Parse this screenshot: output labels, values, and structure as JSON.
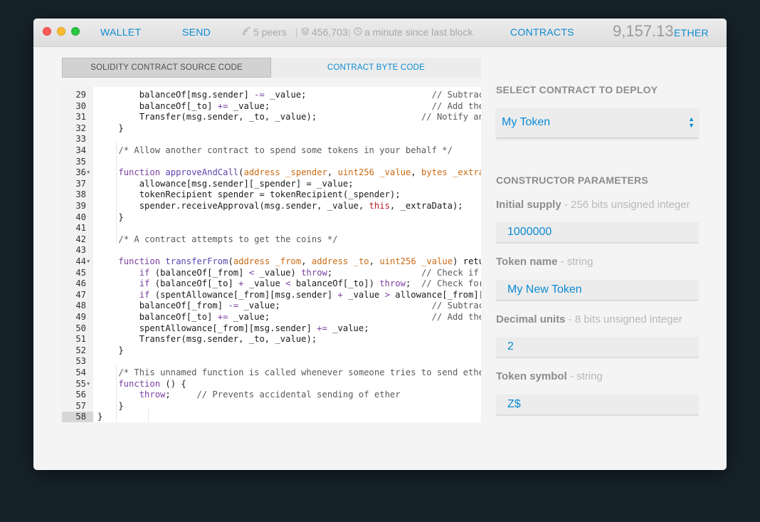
{
  "titlebar": {
    "nav": {
      "wallet": "WALLET",
      "send": "SEND",
      "contracts": "CONTRACTS"
    },
    "stats": {
      "peers": "5 peers",
      "block": "456,703",
      "last_block": "a minute since last block"
    },
    "balance": {
      "amount": "9,157.13",
      "unit": "ETHER"
    }
  },
  "tabs": {
    "source": "SOLIDITY CONTRACT SOURCE CODE",
    "bytecode": "CONTRACT BYTE CODE"
  },
  "editor": {
    "lines": [
      {
        "n": "29",
        "fold": false,
        "current": false
      },
      {
        "n": "30",
        "fold": false,
        "current": false
      },
      {
        "n": "31",
        "fold": false,
        "current": false
      },
      {
        "n": "32",
        "fold": false,
        "current": false
      },
      {
        "n": "33",
        "fold": false,
        "current": false
      },
      {
        "n": "34",
        "fold": false,
        "current": false
      },
      {
        "n": "35",
        "fold": false,
        "current": false
      },
      {
        "n": "36",
        "fold": true,
        "current": false
      },
      {
        "n": "37",
        "fold": false,
        "current": false
      },
      {
        "n": "38",
        "fold": false,
        "current": false
      },
      {
        "n": "39",
        "fold": false,
        "current": false
      },
      {
        "n": "40",
        "fold": false,
        "current": false
      },
      {
        "n": "41",
        "fold": false,
        "current": false
      },
      {
        "n": "42",
        "fold": false,
        "current": false
      },
      {
        "n": "43",
        "fold": false,
        "current": false
      },
      {
        "n": "44",
        "fold": true,
        "current": false
      },
      {
        "n": "45",
        "fold": false,
        "current": false
      },
      {
        "n": "46",
        "fold": false,
        "current": false
      },
      {
        "n": "47",
        "fold": false,
        "current": false
      },
      {
        "n": "48",
        "fold": false,
        "current": false
      },
      {
        "n": "49",
        "fold": false,
        "current": false
      },
      {
        "n": "50",
        "fold": false,
        "current": false
      },
      {
        "n": "51",
        "fold": false,
        "current": false
      },
      {
        "n": "52",
        "fold": false,
        "current": false
      },
      {
        "n": "53",
        "fold": false,
        "current": false
      },
      {
        "n": "54",
        "fold": false,
        "current": false
      },
      {
        "n": "55",
        "fold": true,
        "current": false
      },
      {
        "n": "56",
        "fold": false,
        "current": false
      },
      {
        "n": "57",
        "fold": false,
        "current": false
      },
      {
        "n": "58",
        "fold": false,
        "current": true
      }
    ],
    "code": [
      [
        [
          "",
          "        balanceOf[msg.sender] "
        ],
        [
          "k",
          "-="
        ],
        [
          "",
          " _value;                        "
        ],
        [
          "c",
          "// Subtract from the sender"
        ]
      ],
      [
        [
          "",
          "        balanceOf[_to] "
        ],
        [
          "k",
          "+="
        ],
        [
          "",
          " _value;                               "
        ],
        [
          "c",
          "// Add the same to the recipient"
        ]
      ],
      [
        [
          "",
          "        Transfer(msg.sender, _to, _value);                    "
        ],
        [
          "c",
          "// Notify anyone listening"
        ]
      ],
      [
        [
          "",
          "    }"
        ]
      ],
      [
        [
          "",
          ""
        ]
      ],
      [
        [
          "",
          "    "
        ],
        [
          "c",
          "/* Allow another contract to spend some tokens in your behalf */"
        ]
      ],
      [
        [
          "",
          ""
        ]
      ],
      [
        [
          "",
          "    "
        ],
        [
          "k",
          "function"
        ],
        [
          "",
          " "
        ],
        [
          "f",
          "approveAndCall"
        ],
        [
          "",
          "("
        ],
        [
          "t",
          "address"
        ],
        [
          "",
          " "
        ],
        [
          "t",
          "_spender"
        ],
        [
          "",
          ", "
        ],
        [
          "t",
          "uint256"
        ],
        [
          "",
          " "
        ],
        [
          "t",
          "_value"
        ],
        [
          "",
          ", "
        ],
        [
          "t",
          "bytes"
        ],
        [
          "",
          " "
        ],
        [
          "t",
          "_extraData"
        ],
        [
          "",
          ")"
        ]
      ],
      [
        [
          "",
          "        allowance[msg.sender][_spender] = _value;"
        ]
      ],
      [
        [
          "",
          "        tokenRecipient spender = tokenRecipient(_spender);"
        ]
      ],
      [
        [
          "",
          "        spender.receiveApproval(msg.sender, _value, "
        ],
        [
          "r",
          "this"
        ],
        [
          "",
          ", _extraData);"
        ]
      ],
      [
        [
          "",
          "    }"
        ]
      ],
      [
        [
          "",
          ""
        ]
      ],
      [
        [
          "",
          "    "
        ],
        [
          "c",
          "/* A contract attempts to get the coins */"
        ]
      ],
      [
        [
          "",
          ""
        ]
      ],
      [
        [
          "",
          "    "
        ],
        [
          "k",
          "function"
        ],
        [
          "",
          " "
        ],
        [
          "f",
          "transferFrom"
        ],
        [
          "",
          "("
        ],
        [
          "t",
          "address"
        ],
        [
          "",
          " "
        ],
        [
          "t",
          "_from"
        ],
        [
          "",
          ", "
        ],
        [
          "t",
          "address"
        ],
        [
          "",
          " "
        ],
        [
          "t",
          "_to"
        ],
        [
          "",
          ", "
        ],
        [
          "t",
          "uint256"
        ],
        [
          "",
          " "
        ],
        [
          "t",
          "_value"
        ],
        [
          "",
          ") returns (bool success)"
        ]
      ],
      [
        [
          "",
          "        "
        ],
        [
          "k",
          "if"
        ],
        [
          "",
          " (balanceOf[_from] "
        ],
        [
          "k",
          "<"
        ],
        [
          "",
          " _value) "
        ],
        [
          "k",
          "throw"
        ],
        [
          "",
          ";                 "
        ],
        [
          "c",
          "// Check if the sender has enough"
        ]
      ],
      [
        [
          "",
          "        "
        ],
        [
          "k",
          "if"
        ],
        [
          "",
          " (balanceOf[_to] "
        ],
        [
          "k",
          "+"
        ],
        [
          "",
          " _value "
        ],
        [
          "k",
          "<"
        ],
        [
          "",
          " balanceOf[_to]) "
        ],
        [
          "k",
          "throw"
        ],
        [
          "",
          ";  "
        ],
        [
          "c",
          "// Check for overflows"
        ]
      ],
      [
        [
          "",
          "        "
        ],
        [
          "k",
          "if"
        ],
        [
          "",
          " (spentAllowance[_from][msg.sender] "
        ],
        [
          "k",
          "+"
        ],
        [
          "",
          " _value "
        ],
        [
          "k",
          ">"
        ],
        [
          "",
          " allowance[_from][msg.sender]) throw;"
        ]
      ],
      [
        [
          "",
          "        balanceOf[_from] "
        ],
        [
          "k",
          "-="
        ],
        [
          "",
          " _value;                             "
        ],
        [
          "c",
          "// Subtract from the sender"
        ]
      ],
      [
        [
          "",
          "        balanceOf[_to] "
        ],
        [
          "k",
          "+="
        ],
        [
          "",
          " _value;                               "
        ],
        [
          "c",
          "// Add the same to the recipient"
        ]
      ],
      [
        [
          "",
          "        spentAllowance[_from][msg.sender] "
        ],
        [
          "k",
          "+="
        ],
        [
          "",
          " _value;"
        ]
      ],
      [
        [
          "",
          "        Transfer(msg.sender, _to, _value);"
        ]
      ],
      [
        [
          "",
          "    }"
        ]
      ],
      [
        [
          "",
          ""
        ]
      ],
      [
        [
          "",
          "    "
        ],
        [
          "c",
          "/* This unnamed function is called whenever someone tries to send ether to it */"
        ]
      ],
      [
        [
          "",
          "    "
        ],
        [
          "k",
          "function"
        ],
        [
          "",
          " () {"
        ]
      ],
      [
        [
          "",
          "        "
        ],
        [
          "k",
          "throw"
        ],
        [
          "",
          ";     "
        ],
        [
          "c",
          "// Prevents accidental sending of ether"
        ]
      ],
      [
        [
          "",
          "    }"
        ]
      ],
      [
        [
          "",
          "}"
        ]
      ]
    ]
  },
  "deploy": {
    "select_header": "SELECT CONTRACT TO DEPLOY",
    "selected_contract": "My Token",
    "params_header": "CONSTRUCTOR PARAMETERS",
    "params": [
      {
        "label": "Initial supply",
        "hint": " - 256 bits unsigned integer",
        "value": "1000000"
      },
      {
        "label": "Token name",
        "hint": " - string",
        "value": "My New Token"
      },
      {
        "label": "Decimal units",
        "hint": " - 8 bits unsigned integer",
        "value": "2"
      },
      {
        "label": "Token symbol",
        "hint": " - string",
        "value": "Z$"
      }
    ]
  },
  "colors": {
    "accent": "#0b8bd3",
    "keyword": "#7b3fa0",
    "type": "#c96a13",
    "function": "#5c43b0",
    "this": "#b01d2b"
  },
  "icons": {
    "peers": "signal-icon",
    "block": "layers-icon",
    "time": "clock-icon",
    "select": "updown-arrows-icon"
  }
}
